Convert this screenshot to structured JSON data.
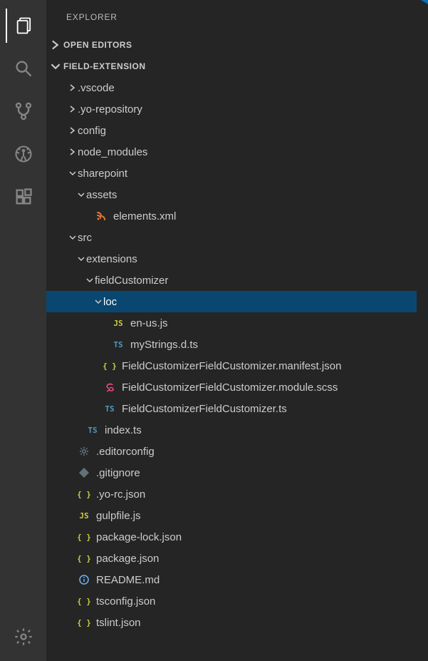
{
  "sidebar": {
    "title": "EXPLORER",
    "openEditors": "OPEN EDITORS",
    "project": "FIELD-EXTENSION"
  },
  "tree": [
    {
      "type": "folder",
      "state": "collapsed",
      "depth": 0,
      "label": ".vscode"
    },
    {
      "type": "folder",
      "state": "collapsed",
      "depth": 0,
      "label": ".yo-repository"
    },
    {
      "type": "folder",
      "state": "collapsed",
      "depth": 0,
      "label": "config"
    },
    {
      "type": "folder",
      "state": "collapsed",
      "depth": 0,
      "label": "node_modules"
    },
    {
      "type": "folder",
      "state": "expanded",
      "depth": 0,
      "label": "sharepoint"
    },
    {
      "type": "folder",
      "state": "expanded",
      "depth": 1,
      "label": "assets"
    },
    {
      "type": "file",
      "icon": "xml",
      "depth": 2,
      "label": "elements.xml"
    },
    {
      "type": "folder",
      "state": "expanded",
      "depth": 0,
      "label": "src"
    },
    {
      "type": "folder",
      "state": "expanded",
      "depth": 1,
      "label": "extensions"
    },
    {
      "type": "folder",
      "state": "expanded",
      "depth": 2,
      "label": "fieldCustomizer"
    },
    {
      "type": "folder",
      "state": "expanded",
      "depth": 3,
      "label": "loc",
      "selected": true
    },
    {
      "type": "file",
      "icon": "js",
      "depth": 4,
      "label": "en-us.js"
    },
    {
      "type": "file",
      "icon": "ts",
      "depth": 4,
      "label": "myStrings.d.ts"
    },
    {
      "type": "file",
      "icon": "json",
      "depth": 3,
      "label": "FieldCustomizerFieldCustomizer.manifest.json"
    },
    {
      "type": "file",
      "icon": "scss",
      "depth": 3,
      "label": "FieldCustomizerFieldCustomizer.module.scss"
    },
    {
      "type": "file",
      "icon": "ts",
      "depth": 3,
      "label": "FieldCustomizerFieldCustomizer.ts"
    },
    {
      "type": "file",
      "icon": "ts",
      "depth": 1,
      "label": "index.ts"
    },
    {
      "type": "file",
      "icon": "cfg",
      "depth": 0,
      "label": ".editorconfig"
    },
    {
      "type": "file",
      "icon": "git",
      "depth": 0,
      "label": ".gitignore"
    },
    {
      "type": "file",
      "icon": "json",
      "depth": 0,
      "label": ".yo-rc.json"
    },
    {
      "type": "file",
      "icon": "js",
      "depth": 0,
      "label": "gulpfile.js"
    },
    {
      "type": "file",
      "icon": "json",
      "depth": 0,
      "label": "package-lock.json"
    },
    {
      "type": "file",
      "icon": "json",
      "depth": 0,
      "label": "package.json"
    },
    {
      "type": "file",
      "icon": "info",
      "depth": 0,
      "label": "README.md"
    },
    {
      "type": "file",
      "icon": "json",
      "depth": 0,
      "label": "tsconfig.json"
    },
    {
      "type": "file",
      "icon": "json",
      "depth": 0,
      "label": "tslint.json"
    }
  ]
}
